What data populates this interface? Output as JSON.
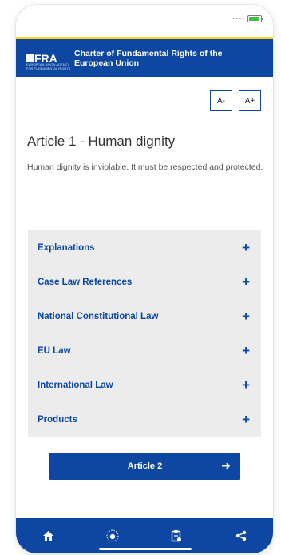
{
  "app": {
    "logo_text": "FRA",
    "logo_tagline": "EUROPEAN UNION AGENCY FOR FUNDAMENTAL RIGHTS",
    "title": "Charter of Fundamental Rights of the European Union"
  },
  "font_controls": {
    "decrease": "A-",
    "increase": "A+"
  },
  "article": {
    "title": "Article 1 - Human dignity",
    "text": "Human dignity is inviolable. It must be respected and protected."
  },
  "sections": [
    {
      "label": "Explanations"
    },
    {
      "label": "Case Law References"
    },
    {
      "label": "National Constitutional Law"
    },
    {
      "label": "EU Law"
    },
    {
      "label": "International Law"
    },
    {
      "label": "Products"
    }
  ],
  "next_button": {
    "label": "Article 2"
  },
  "nav": {
    "icons": [
      "home-icon",
      "eu-stars-icon",
      "clipboard-icon",
      "share-icon"
    ]
  },
  "colors": {
    "primary": "#0d47a1",
    "accent": "#ffd617",
    "accordion_bg": "#ececec",
    "battery": "#3cc23c"
  }
}
